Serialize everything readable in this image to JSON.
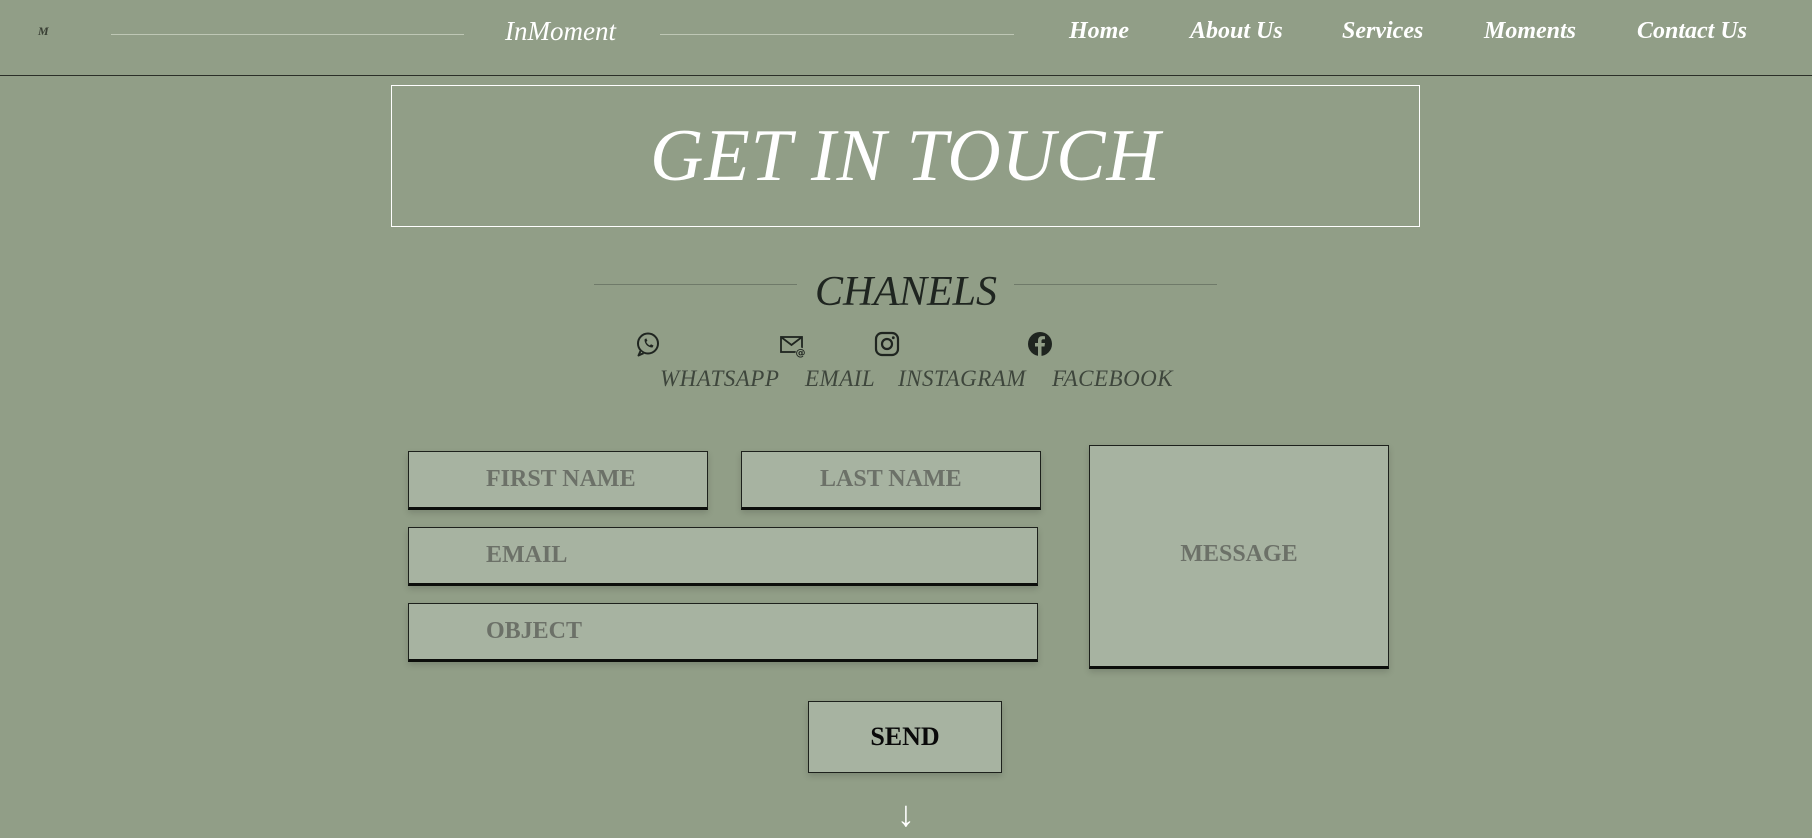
{
  "header": {
    "logo": "M",
    "brand": "InMoment",
    "nav": [
      "Home",
      "About Us",
      "Services",
      "Moments",
      "Contact Us"
    ]
  },
  "hero": {
    "title": "GET IN TOUCH"
  },
  "channels": {
    "title": "CHANELS",
    "items": [
      {
        "label": "WHATSAPP",
        "icon": "whatsapp-icon"
      },
      {
        "label": "EMAIL",
        "icon": "email-icon"
      },
      {
        "label": "INSTAGRAM",
        "icon": "instagram-icon"
      },
      {
        "label": "FACEBOOK",
        "icon": "facebook-icon"
      }
    ]
  },
  "form": {
    "first_name_placeholder": "FIRST NAME",
    "last_name_placeholder": "LAST NAME",
    "email_placeholder": "EMAIL",
    "object_placeholder": "OBJECT",
    "message_placeholder": "MESSAGE",
    "send_label": "SEND"
  },
  "scroll_arrow": "↓",
  "colors": {
    "background": "#919e87",
    "field": "#a7b3a1",
    "text_light": "#ffffff",
    "text_dark": "#1f2520"
  }
}
